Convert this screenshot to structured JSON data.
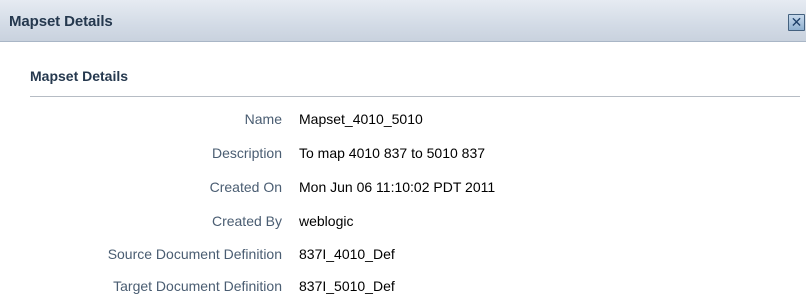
{
  "dialog": {
    "title": "Mapset Details",
    "close_icon": "close-x-icon"
  },
  "section": {
    "title": "Mapset Details"
  },
  "fields": [
    {
      "label": "Name",
      "value": "Mapset_4010_5010"
    },
    {
      "label": "Description",
      "value": "To map 4010 837 to 5010 837"
    },
    {
      "label": "Created On",
      "value": "Mon Jun 06 11:10:02 PDT 2011"
    },
    {
      "label": "Created By",
      "value": "weblogic"
    },
    {
      "label": "Source Document Definition",
      "value": "837I_4010_Def"
    },
    {
      "label": "Target Document Definition",
      "value": "837I_5010_Def"
    }
  ],
  "colors": {
    "titlebar_bg": "#d3dbe6",
    "title_text": "#25384e",
    "label_text": "#4a5d72",
    "value_text": "#000000"
  }
}
